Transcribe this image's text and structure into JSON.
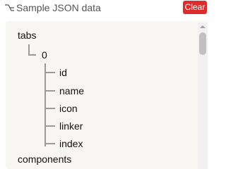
{
  "header": {
    "title": "Sample JSON data",
    "clear_label": "Clear",
    "icon": "tree-structure-icon",
    "accent_color": "#dc2d2d"
  },
  "tree": {
    "root": "tabs",
    "index": "0",
    "fields": [
      "id",
      "name",
      "icon",
      "linker",
      "index"
    ],
    "next": "components"
  },
  "colors": {
    "panel_background": "#f7f6f3",
    "connector": "#9a9a9a"
  }
}
